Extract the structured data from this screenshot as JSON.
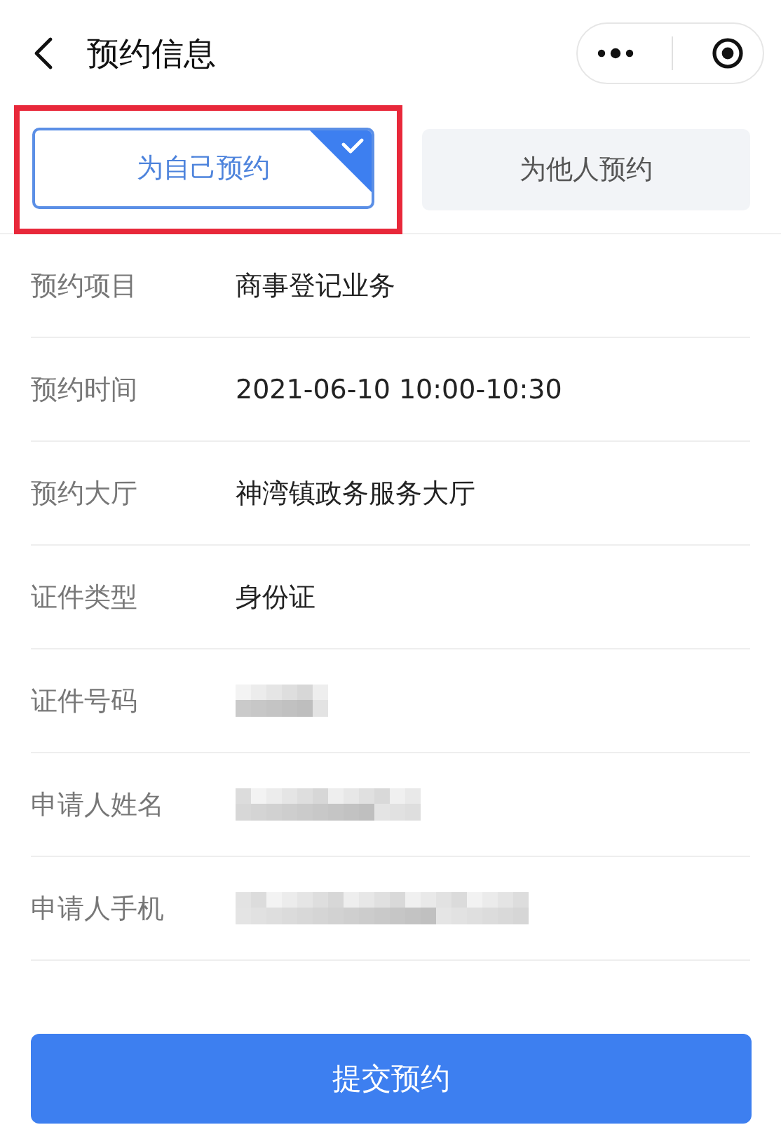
{
  "header": {
    "title": "预约信息"
  },
  "tabs": {
    "highlighted": true,
    "items": [
      {
        "label": "为自己预约",
        "selected": true
      },
      {
        "label": "为他人预约",
        "selected": false
      }
    ]
  },
  "fields": [
    {
      "kind": "text",
      "label": "预约项目",
      "value": "商事登记业务"
    },
    {
      "kind": "text",
      "label": "预约时间",
      "value": "2021-06-10 10:00-10:30"
    },
    {
      "kind": "text",
      "label": "预约大厅",
      "value": "神湾镇政务服务大厅"
    },
    {
      "kind": "text",
      "label": "证件类型",
      "value": "身份证"
    },
    {
      "kind": "redacted",
      "label": "证件号码"
    },
    {
      "kind": "redacted",
      "label": "申请人姓名"
    },
    {
      "kind": "redacted",
      "label": "申请人手机"
    }
  ],
  "submit_button": "提交预约"
}
